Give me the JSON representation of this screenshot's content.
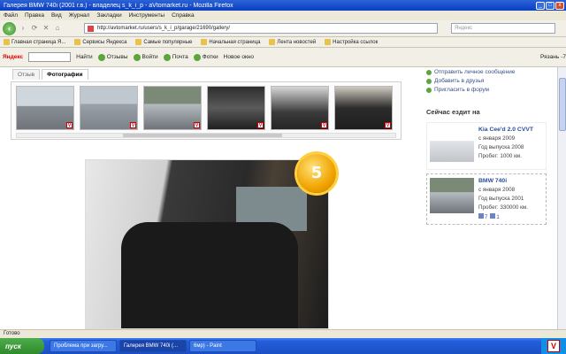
{
  "window": {
    "title": "Галерея BMW 740i (2001 г.в.) - владелец s_k_i_p - aVtomarket.ru - Mozilla Firefox"
  },
  "menu": [
    "Файл",
    "Правка",
    "Вид",
    "Журнал",
    "Закладки",
    "Инструменты",
    "Справка"
  ],
  "nav": {
    "url": "http://avtomarket.ru/users/s_k_i_p/garage/21690/gallery/",
    "search_placeholder": "Яндекс"
  },
  "bookmarks": [
    "Главная страница Я...",
    "Сервисы Яндекса",
    "Самые популярные",
    "Начальная страница",
    "Лента новостей",
    "Настройка ссылок"
  ],
  "yandex_toolbar": {
    "logo": "Яндекс",
    "find": "Найти",
    "reviews": "Отзывы",
    "login": "Войти",
    "mail": "Почта",
    "photos": "Фотки",
    "new_window": "Новое окно",
    "weather": "Рязань",
    "temp": "-7"
  },
  "tabs": [
    "Отзыв",
    "Фотографии"
  ],
  "main_photo": {
    "rating": "5"
  },
  "sidebar": {
    "links": [
      "Отправить личное сообщение",
      "Добавить в друзья",
      "Пригласить в форум"
    ],
    "now_driving_title": "Сейчас ездит на",
    "cars": [
      {
        "name": "Kia Cee'd 2.0 CVVT",
        "since": "с января 2009",
        "year": "Год выпуска 2008",
        "mileage": "Пробег: 1000 км."
      },
      {
        "name": "BMW 740i",
        "since": "с января 2008",
        "year": "Год выпуска 2001",
        "mileage": "Пробег: 330000 км.",
        "photos": "7",
        "comments": "1"
      }
    ]
  },
  "status": "Готово",
  "taskbar": {
    "start": "пуск",
    "tasks": [
      "Проблема при загру...",
      "Галерея BMW 740i (...",
      "6мр) - Paint"
    ]
  },
  "colors": {
    "accent": "#2a4f9a",
    "badge": "#f0a300",
    "titlebar": "#0a3fc0"
  }
}
